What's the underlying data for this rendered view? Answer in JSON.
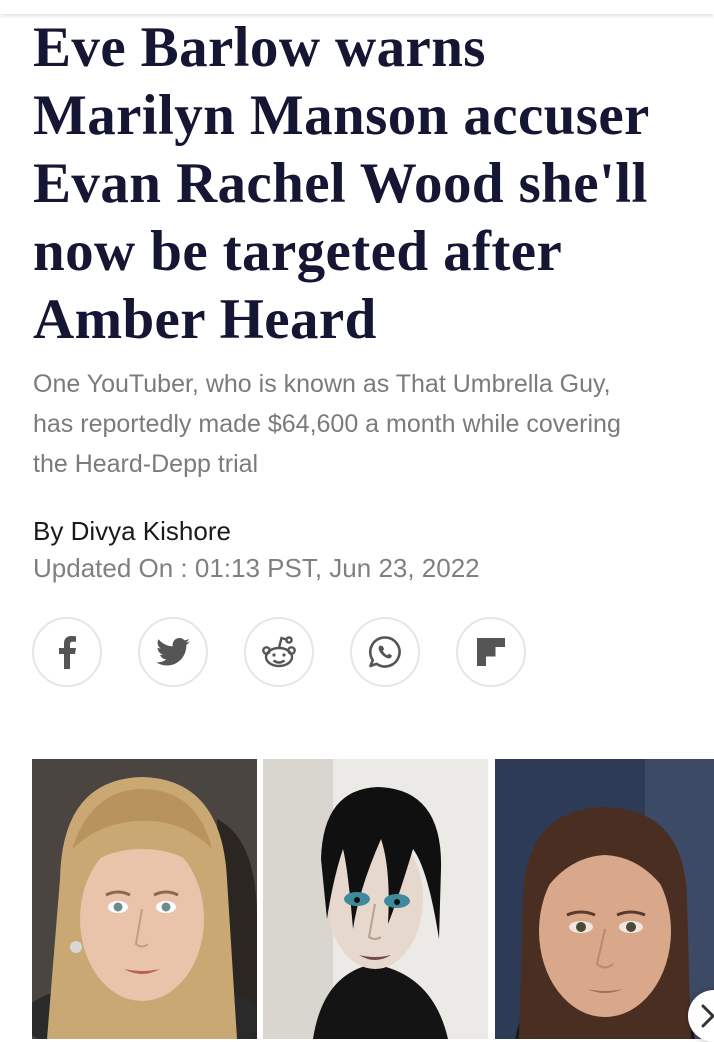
{
  "article": {
    "headline_lines": [
      "Eve Barlow warns",
      "Marilyn Manson accuser",
      "Evan Rachel Wood she'll",
      "now be targeted after",
      "Amber Heard"
    ],
    "subtitle_lines": [
      "One YouTuber, who is known as That Umbrella Guy,",
      "has reportedly made $64,600 a month while covering",
      "the Heard-Depp trial"
    ],
    "byline": "By Divya Kishore",
    "updated": "Updated On : 01:13 PST, Jun 23, 2022"
  },
  "share_buttons": [
    {
      "name": "facebook",
      "icon": "facebook-icon"
    },
    {
      "name": "twitter",
      "icon": "twitter-icon"
    },
    {
      "name": "reddit",
      "icon": "reddit-icon"
    },
    {
      "name": "whatsapp",
      "icon": "whatsapp-icon"
    },
    {
      "name": "flipboard",
      "icon": "flipboard-icon"
    }
  ],
  "gallery": {
    "photos": [
      "amber-heard-photo",
      "marilyn-manson-photo",
      "evan-rachel-wood-photo"
    ],
    "next_icon": "chevron-right-icon"
  },
  "colors": {
    "headline": "#151633",
    "subtitle": "#7b7b7b",
    "byline": "#1a1a1a",
    "updated": "#808080",
    "share_icon": "#555555",
    "share_border": "#e6e6e6"
  }
}
